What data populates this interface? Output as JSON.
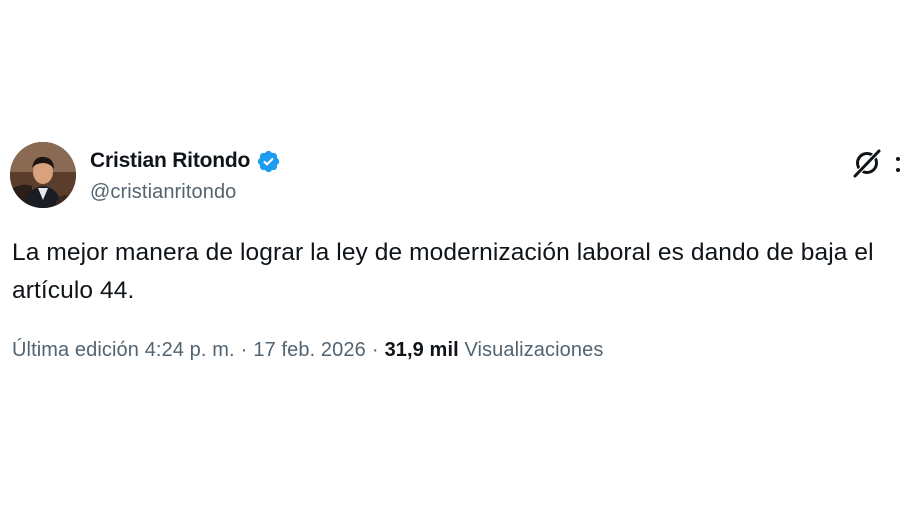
{
  "tweet": {
    "author": {
      "display_name": "Cristian Ritondo",
      "handle": "@cristianritondo",
      "verified_icon": "verified-badge-icon",
      "avatar_icon": "avatar"
    },
    "text": "La mejor manera de lograr la ley de modernización laboral es dando de baja el artículo 44.",
    "meta": {
      "edited_label": "Última edición",
      "time": "4:24 p. m.",
      "separator": "·",
      "date": "17 feb. 2026",
      "views_count": "31,9 mil",
      "views_label": "Visualizaciones"
    },
    "actions": {
      "grok_icon": "grok-icon",
      "more_icon": "more-icon"
    }
  },
  "colors": {
    "text_primary": "#0f1419",
    "text_secondary": "#536471",
    "verified_blue": "#1d9bf0",
    "background": "#ffffff"
  }
}
